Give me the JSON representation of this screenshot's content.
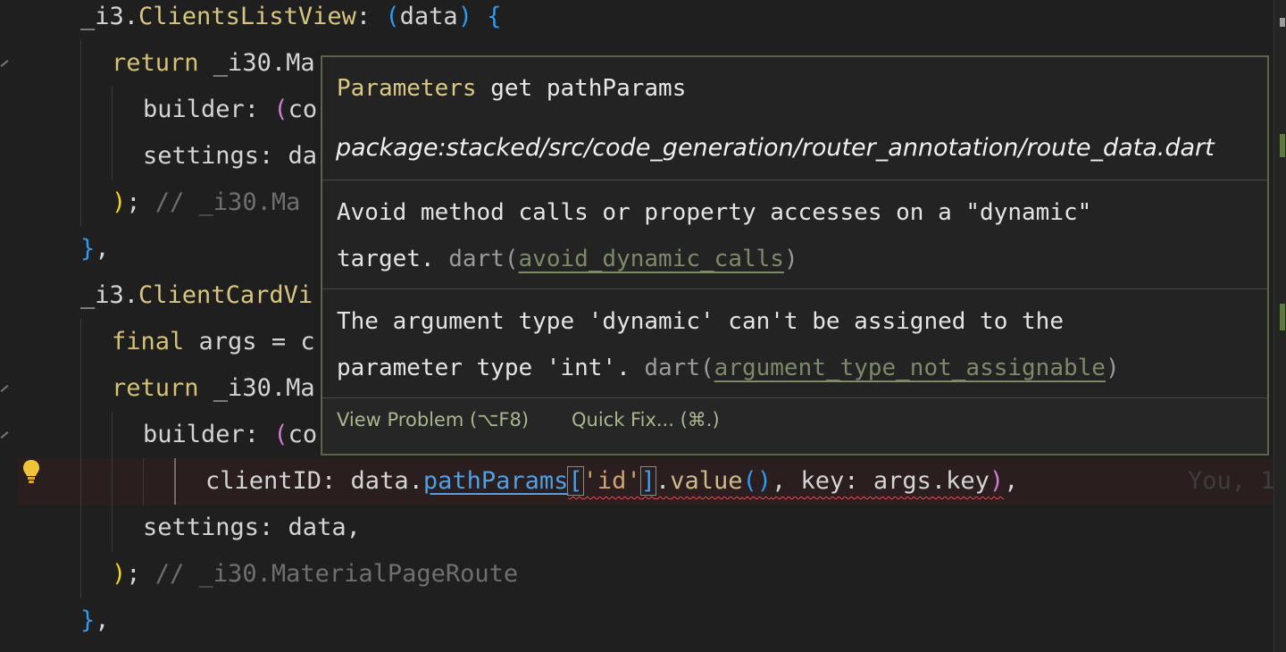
{
  "editor": {
    "lines": [
      {
        "segs": [
          [
            "",
            "_i3."
          ],
          [
            "t",
            "ClientsListView"
          ],
          [
            "",
            ": "
          ],
          [
            "p3",
            "("
          ],
          [
            "",
            "data"
          ],
          [
            "p3",
            ")"
          ],
          [
            "",
            " "
          ],
          [
            "p3",
            "{"
          ]
        ]
      },
      {
        "segs": [
          [
            "k",
            "return"
          ],
          [
            "",
            " _i30.Ma"
          ]
        ]
      },
      {
        "segs": [
          [
            "",
            "builder: "
          ],
          [
            "p2",
            "("
          ],
          [
            "",
            "co"
          ]
        ]
      },
      {
        "segs": [
          [
            "",
            "settings: da"
          ]
        ]
      },
      {
        "segs": [
          [
            "p1",
            ")"
          ],
          [
            "",
            "; "
          ],
          [
            "cm",
            "// _i30.Ma"
          ]
        ]
      },
      {
        "segs": [
          [
            "p3",
            "}"
          ],
          [
            "",
            ","
          ]
        ]
      },
      {
        "segs": [
          [
            "",
            "_i3."
          ],
          [
            "t",
            "ClientCardVi"
          ]
        ]
      },
      {
        "segs": [
          [
            "k",
            "final"
          ],
          [
            "",
            " args = c"
          ]
        ]
      },
      {
        "segs": [
          [
            "k",
            "return"
          ],
          [
            "",
            " _i30.Ma"
          ]
        ]
      },
      {
        "segs": [
          [
            "",
            "builder: "
          ],
          [
            "p2",
            "("
          ],
          [
            "",
            "co"
          ]
        ]
      },
      {
        "segs": [
          [
            "",
            "clientID: data."
          ],
          [
            "link",
            "pathParams"
          ],
          [
            "bm",
            "["
          ],
          [
            "s",
            "'id'"
          ],
          [
            "bm",
            "]"
          ],
          [
            "",
            "."
          ],
          [
            "m",
            "value"
          ],
          [
            "p3",
            "()"
          ],
          [
            "",
            ", key: args.key"
          ],
          [
            "p2",
            ")"
          ],
          [
            "",
            ","
          ]
        ]
      },
      {
        "segs": [
          [
            "",
            "settings: data,"
          ]
        ]
      },
      {
        "segs": [
          [
            "p1",
            ")"
          ],
          [
            "",
            "; "
          ],
          [
            "cm",
            "// _i30.MaterialPageRoute"
          ]
        ]
      },
      {
        "segs": [
          [
            "p3",
            "}"
          ],
          [
            "",
            ","
          ]
        ]
      }
    ],
    "blame_text": "You, 1"
  },
  "hover": {
    "signature_keyword": "Parameters",
    "signature_rest": " get pathParams",
    "package_path": "package:stacked/src/code_generation/router_annotation/route_data.dart",
    "problem1": {
      "line1": "Avoid method calls or property accesses on a \"dynamic\"",
      "line2_text": "target. ",
      "source": "dart",
      "code": "avoid_dynamic_calls"
    },
    "problem2": {
      "line1": "The argument type 'dynamic' can't be assigned to the",
      "line2_text": "parameter type 'int'. ",
      "source": "dart",
      "code": "argument_type_not_assignable"
    },
    "actions": {
      "view_problem": "View Problem (⌥F8)",
      "quick_fix": "Quick Fix... (⌘.)"
    }
  },
  "colors": {
    "background": "#1f1f1f",
    "hover_border": "#5c6647",
    "error_squiggle": "#e05050",
    "action_text": "#a9b78b"
  },
  "icons": [
    "lightbulb-icon"
  ]
}
